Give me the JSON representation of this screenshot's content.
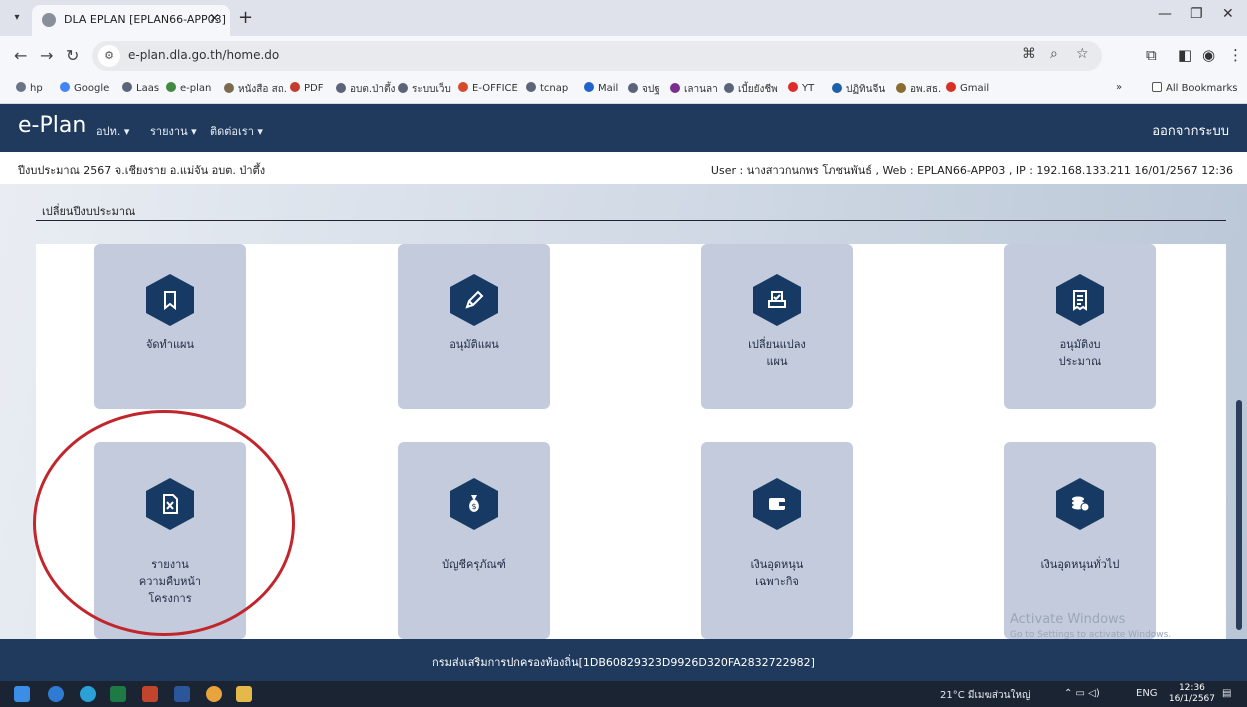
{
  "browser": {
    "tab_title": "DLA EPLAN [EPLAN66-APP03]",
    "tab_close": "×",
    "new_tab": "+",
    "url": "e-plan.dla.go.th/home.do"
  },
  "bookmarks": [
    {
      "label": "hp",
      "color": "#6b7486"
    },
    {
      "label": "Google",
      "color": "#4285f4"
    },
    {
      "label": "Laas",
      "color": "#5b6478"
    },
    {
      "label": "e-plan",
      "color": "#3f8a3f"
    },
    {
      "label": "หนังสือ สถ.",
      "color": "#7a6a4f"
    },
    {
      "label": "PDF",
      "color": "#c43b2f"
    },
    {
      "label": "อบต.ป่าตึ้ง",
      "color": "#5b6478"
    },
    {
      "label": "ระบบเว็บ",
      "color": "#5b6478"
    },
    {
      "label": "E-OFFICE",
      "color": "#d64a2b"
    },
    {
      "label": "tcnap",
      "color": "#5b6478"
    },
    {
      "label": "Mail",
      "color": "#1f65c9"
    },
    {
      "label": "จปฐ",
      "color": "#5b6478"
    },
    {
      "label": "เลานลา",
      "color": "#7a2f8e"
    },
    {
      "label": "เบี้ยยังชีพ",
      "color": "#5b6478"
    },
    {
      "label": "YT",
      "color": "#e02b2b"
    },
    {
      "label": "ปฏิทินจีน",
      "color": "#1d5fa8"
    },
    {
      "label": "อพ.สธ.",
      "color": "#8b6b2e"
    },
    {
      "label": "Gmail",
      "color": "#d93025"
    }
  ],
  "bookmarks_more": "»",
  "all_bookmarks": "All Bookmarks",
  "app": {
    "logo": "e-Plan",
    "menu": [
      "อปท. ▾",
      "รายงาน ▾",
      "ติดต่อเรา ▾"
    ],
    "logout": "ออกจากระบบ"
  },
  "info": {
    "left": "ปีงบประมาณ 2567   จ.เชียงราย อ.แม่จัน อบต. ป่าตึ้ง",
    "right": "User : นางสาวกนกพร โภชนพันธ์ , Web : EPLAN66-APP03 , IP : 192.168.133.211 16/01/2567 12:36"
  },
  "change_year": "เปลี่ยนปีงบประมาณ",
  "tiles": [
    {
      "lines": [
        "จัดทำแผน"
      ],
      "icon": "bookmark-icon"
    },
    {
      "lines": [
        "อนุมัติแผน"
      ],
      "icon": "pencil-icon"
    },
    {
      "lines": [
        "เปลี่ยนแปลง",
        "แผน"
      ],
      "icon": "edit-document-icon"
    },
    {
      "lines": [
        "อนุมัติงบ",
        "ประมาณ"
      ],
      "icon": "receipt-icon"
    },
    {
      "lines": [
        "รายงาน",
        "ความคืบหน้า",
        "โครงการ"
      ],
      "icon": "excel-file-icon"
    },
    {
      "lines": [
        "บัญชีครุภัณฑ์"
      ],
      "icon": "money-bag-icon"
    },
    {
      "lines": [
        "เงินอุดหนุน",
        "เฉพาะกิจ"
      ],
      "icon": "wallet-icon"
    },
    {
      "lines": [
        "เงินอุดหนุนทั่วไป"
      ],
      "icon": "coins-icon"
    }
  ],
  "watermark": {
    "title": "Activate Windows",
    "sub": "Go to Settings to activate Windows."
  },
  "footer": "กรมส่งเสริมการปกครองท้องถิ่น[1DB60829323D9926D320FA2832722982]",
  "taskbar": {
    "weather": "21°C มีเมฆส่วนใหญ่",
    "lang": "ENG",
    "time": "12:36",
    "date": "16/1/2567"
  },
  "colors": {
    "header": "#1f3a5c",
    "hex": "#163a63",
    "tile": "#c3cbdc",
    "highlight": "#c0262c"
  }
}
